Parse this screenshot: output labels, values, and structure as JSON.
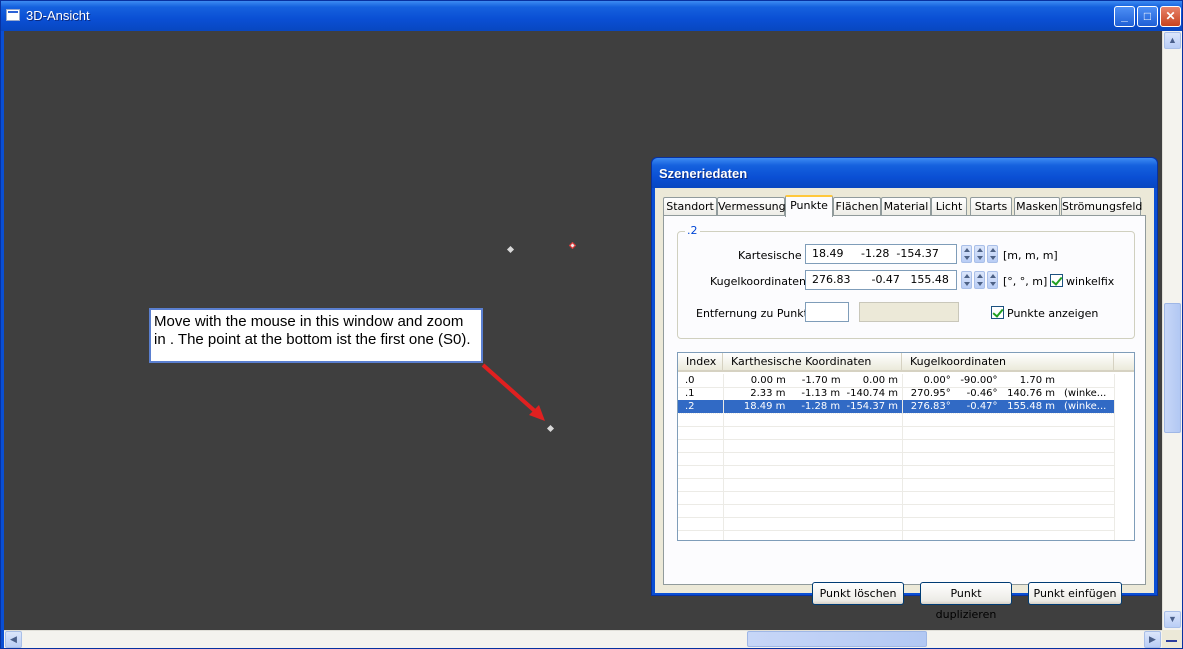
{
  "window": {
    "title": "3D-Ansicht"
  },
  "note": {
    "text": "Move with the mouse in this window and zoom in . The point at the bottom ist the first one (S0)."
  },
  "dialog": {
    "title": "Szeneriedaten",
    "tabs": [
      "Standort",
      "Vermessung",
      "Punkte",
      "Flächen",
      "Material",
      "Licht",
      "Starts",
      "Masken",
      "Strömungsfeld"
    ],
    "active_tab": "Punkte",
    "group_label": ".2",
    "kartesische_label": "Kartesische",
    "kartesische_value": "18.49     -1.28  -154.37",
    "kartesische_unit": "[m, m, m]",
    "kugel_label": "Kugelkoordinaten",
    "kugel_value": "276.83      -0.47   155.48",
    "kugel_unit": "[°, °, m]",
    "winkelfix_label": "winkelfix",
    "winkelfix_checked": true,
    "entfernung_label": "Entfernung zu Punkt",
    "entfernung_value": "",
    "punkte_anzeigen_label": "Punkte anzeigen",
    "punkte_anzeigen_checked": true,
    "table": {
      "headers": [
        "Index",
        "Karthesische Koordinaten",
        "Kugelkoordinaten"
      ],
      "rows": [
        {
          "index": ".0",
          "cart": "0.00 m     -1.70 m       0.00 m",
          "kugel": "0.00°   -90.00°       1.70 m",
          "extra": ""
        },
        {
          "index": ".1",
          "cart": "2.33 m     -1.13 m  -140.74 m",
          "kugel": "270.95°     -0.46°   140.76 m",
          "extra": "(winke..."
        },
        {
          "index": ".2",
          "cart": "18.49 m     -1.28 m  -154.37 m",
          "kugel": "276.83°     -0.47°   155.48 m",
          "extra": "(winke..."
        }
      ],
      "selected_row": 2
    },
    "buttons": {
      "delete": "Punkt löschen",
      "duplicate": "Punkt duplizieren",
      "insert": "Punkt einfügen"
    }
  },
  "colors": {
    "viewport_bg": "#3f3f3f",
    "titlebar": "#0a4fd4",
    "selection": "#316ac5",
    "arrow": "#e02020"
  }
}
